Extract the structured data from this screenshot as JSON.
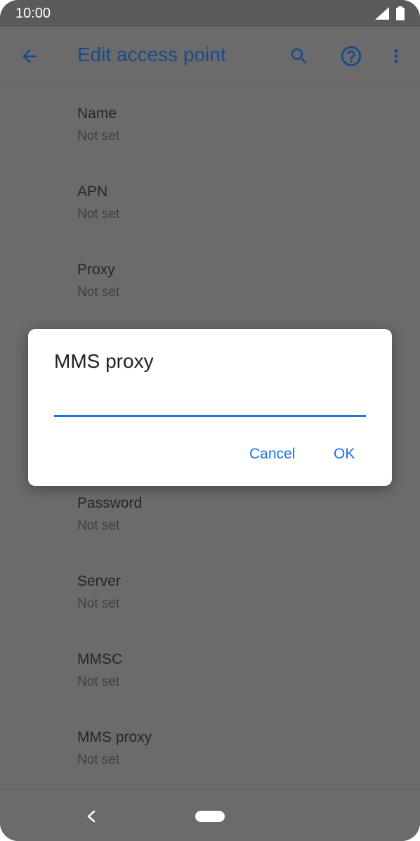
{
  "status_bar": {
    "time": "10:00"
  },
  "app_bar": {
    "title": "Edit access point",
    "icons": [
      "back-arrow-icon",
      "search-icon",
      "help-icon",
      "more-vert-icon"
    ]
  },
  "settings": [
    {
      "title": "Name",
      "value": "Not set"
    },
    {
      "title": "APN",
      "value": "Not set"
    },
    {
      "title": "Proxy",
      "value": "Not set"
    },
    {
      "title": "Password",
      "value": "Not set"
    },
    {
      "title": "Server",
      "value": "Not set"
    },
    {
      "title": "MMSC",
      "value": "Not set"
    },
    {
      "title": "MMS proxy",
      "value": "Not set"
    }
  ],
  "dialog": {
    "title": "MMS proxy",
    "input_value": "",
    "cancel_label": "Cancel",
    "ok_label": "OK"
  },
  "colors": {
    "accent": "#1a73e8",
    "title_blue": "#1c4a87",
    "scrim_background": "#6b6b6b"
  }
}
